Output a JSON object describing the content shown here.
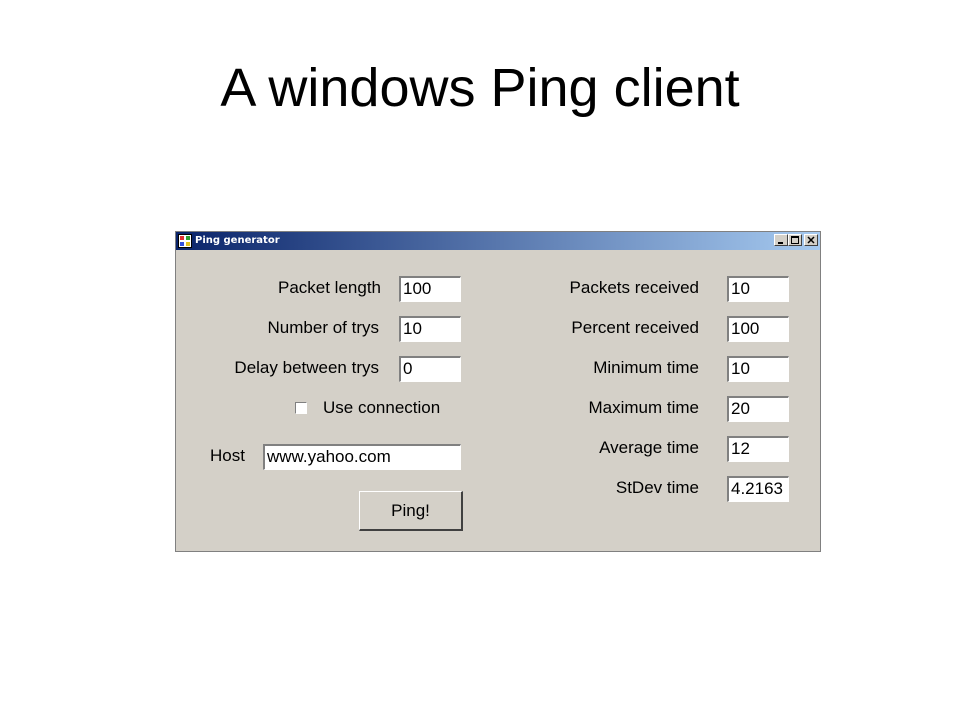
{
  "slide": {
    "title": "A windows Ping client"
  },
  "window": {
    "title": "Ping generator",
    "icon": "app-window-icon",
    "controls": [
      "minimize-icon",
      "maximize-icon",
      "close-icon"
    ]
  },
  "inputs": {
    "packet_length": {
      "label": "Packet length",
      "value": "100"
    },
    "number_of_trys": {
      "label": "Number of trys",
      "value": "10"
    },
    "delay_between_trys": {
      "label": "Delay between trys",
      "value": "0"
    },
    "use_connection": {
      "label": "Use connection",
      "checked": false
    },
    "host": {
      "label": "Host",
      "value": "www.yahoo.com"
    },
    "ping_button": {
      "label": "Ping!"
    }
  },
  "results": {
    "packets_received": {
      "label": "Packets received",
      "value": "10"
    },
    "percent_received": {
      "label": "Percent received",
      "value": "100"
    },
    "minimum_time": {
      "label": "Minimum time",
      "value": "10"
    },
    "maximum_time": {
      "label": "Maximum time",
      "value": "20"
    },
    "average_time": {
      "label": "Average time",
      "value": "12"
    },
    "stdev_time": {
      "label": "StDev time",
      "value": "4.2163"
    }
  },
  "colors": {
    "window_bg": "#d4d0c8",
    "titlebar_start": "#0a246a",
    "titlebar_end": "#a6caf0"
  }
}
